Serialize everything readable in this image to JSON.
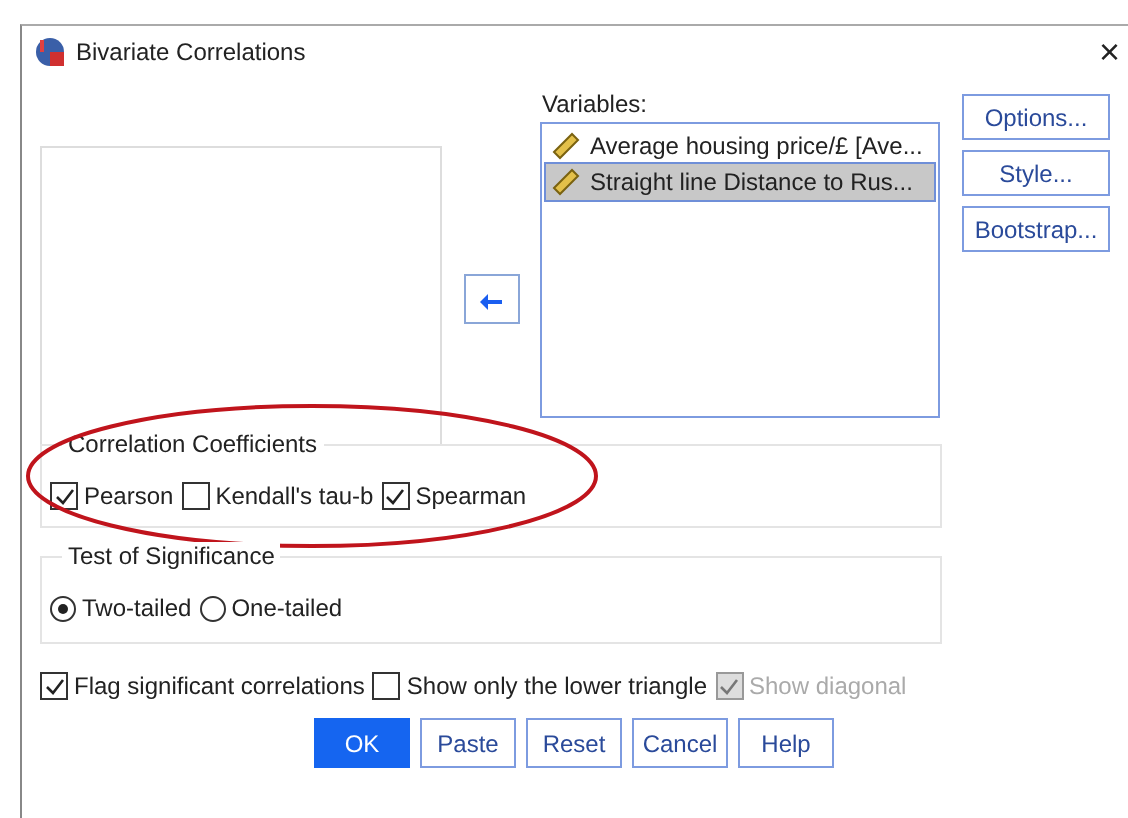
{
  "window": {
    "title": "Bivariate Correlations",
    "close": "×"
  },
  "variables": {
    "label": "Variables:",
    "items": [
      {
        "name": "Average housing price/£ [Ave...",
        "selected": false
      },
      {
        "name": "Straight line Distance to Rus...",
        "selected": true
      }
    ]
  },
  "side_buttons": [
    "Options...",
    "Style...",
    "Bootstrap..."
  ],
  "correlation_coefficients": {
    "title": "Correlation Coefficients",
    "options": [
      {
        "label": "Pearson",
        "checked": true
      },
      {
        "label": "Kendall's tau-b",
        "checked": false
      },
      {
        "label": "Spearman",
        "checked": true
      }
    ]
  },
  "test_of_significance": {
    "title": "Test of Significance",
    "options": [
      {
        "label": "Two-tailed",
        "selected": true
      },
      {
        "label": "One-tailed",
        "selected": false
      }
    ]
  },
  "flags": [
    {
      "label": "Flag significant correlations",
      "checked": true,
      "disabled": false
    },
    {
      "label": "Show only the lower triangle",
      "checked": false,
      "disabled": false
    },
    {
      "label": "Show diagonal",
      "checked": true,
      "disabled": true
    }
  ],
  "buttons": [
    {
      "label": "OK",
      "kind": "default"
    },
    {
      "label": "Paste",
      "kind": "normal"
    },
    {
      "label": "Reset",
      "kind": "normal"
    },
    {
      "label": "Cancel",
      "kind": "normal"
    },
    {
      "label": "Help",
      "kind": "normal"
    }
  ]
}
